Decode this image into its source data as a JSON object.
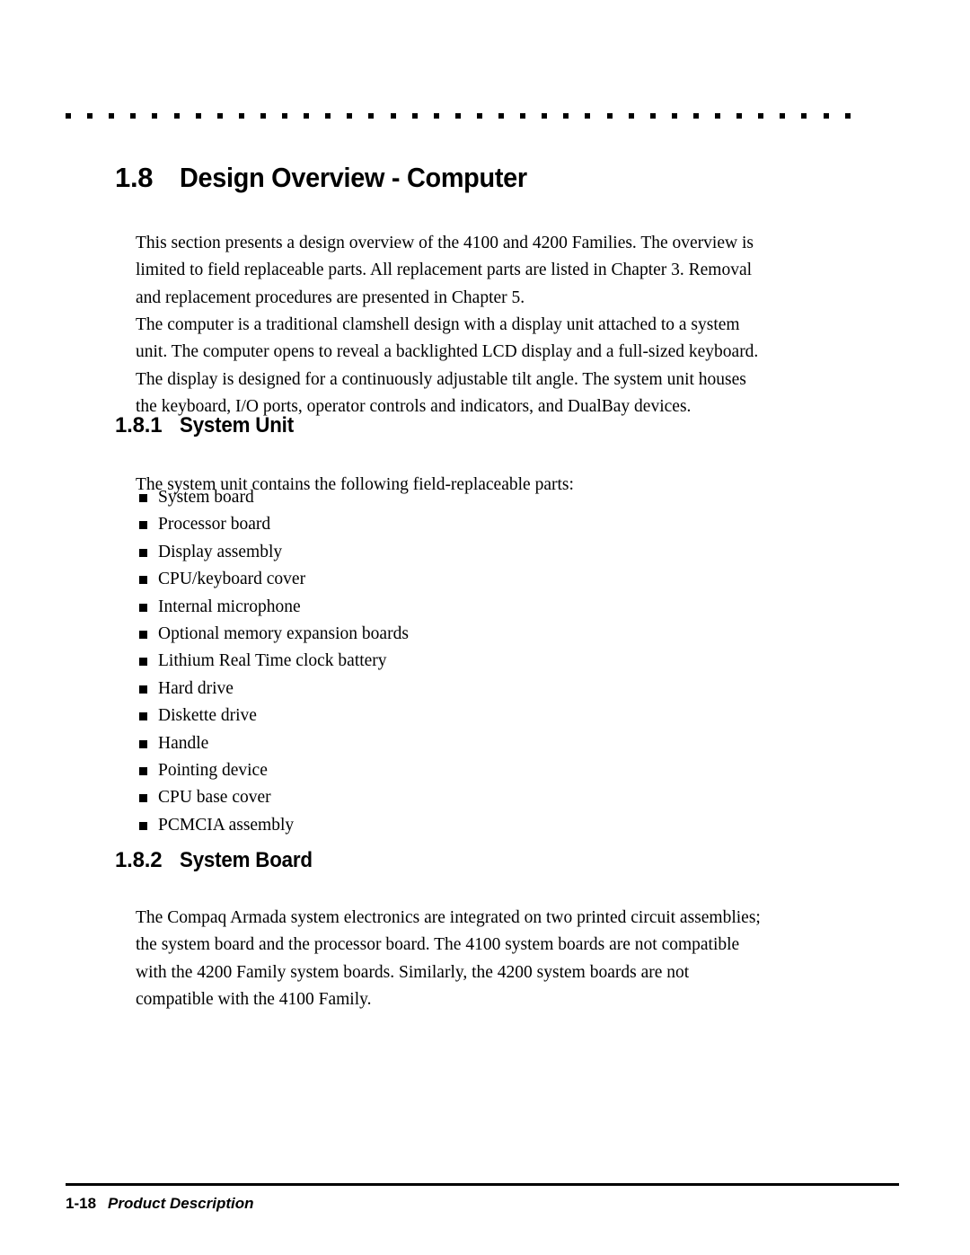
{
  "document": {
    "section_heading": {
      "number": "1.8",
      "title": "Design Overview - Computer"
    },
    "paragraphs": {
      "intro": "This section presents a design overview of the 4100 and 4200 Families. The overview is limited to field replaceable parts. All replacement parts are listed in Chapter 3. Removal and replacement procedures are presented in Chapter 5.",
      "clamshell": "The computer is a traditional clamshell design with a display unit attached to a system unit. The computer opens to reveal a backlighted LCD display and a full-sized keyboard. The display is designed for a continuously adjustable tilt angle. The system unit houses the keyboard, I/O ports, operator controls and indicators, and DualBay devices.",
      "list_lead_in": "The system unit contains the following field-replaceable parts:",
      "system_board": "The Compaq Armada system electronics are integrated on two printed circuit assemblies; the system board and the processor board. The 4100 system boards are not compatible with the 4200 Family system boards. Similarly, the 4200 system boards are not compatible with the 4100 Family."
    },
    "subsections": [
      {
        "number": "1.8.1",
        "title": "System Unit"
      },
      {
        "number": "1.8.2",
        "title": "System Board"
      }
    ],
    "system_unit_parts": [
      "System board",
      "Processor board",
      "Display assembly",
      "CPU/keyboard cover",
      "Internal microphone",
      "Optional memory expansion boards",
      "Lithium Real Time clock battery",
      "Hard drive",
      "Diskette drive",
      "Handle",
      "Pointing device",
      "CPU base cover",
      "PCMCIA assembly"
    ],
    "footer": {
      "page_number": "1-18",
      "section_name": "Product Description"
    },
    "style": {
      "ink_color": "#000000",
      "page_color": "#ffffff"
    }
  }
}
